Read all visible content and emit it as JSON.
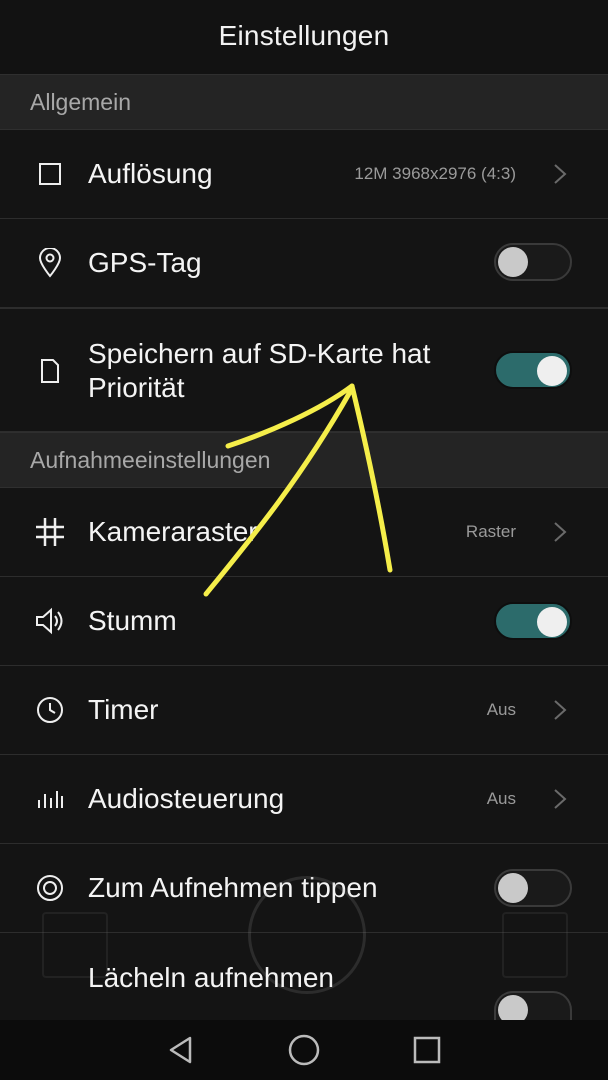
{
  "header": {
    "title": "Einstellungen"
  },
  "sections": {
    "general": "Allgemein",
    "recording": "Aufnahmeeinstellungen"
  },
  "rows": {
    "resolution": {
      "label": "Auflösung",
      "value": "12M 3968x2976 (4:3)"
    },
    "gps": {
      "label": "GPS-Tag",
      "toggle": "off"
    },
    "sd": {
      "label_line1": "Speichern auf SD-Karte hat",
      "label_line2": "Priorität",
      "toggle": "on"
    },
    "grid": {
      "label": "Kameraraster",
      "value": "Raster"
    },
    "mute": {
      "label": "Stumm",
      "toggle": "on"
    },
    "timer": {
      "label": "Timer",
      "value": "Aus"
    },
    "audio": {
      "label": "Audiosteuerung",
      "value": "Aus"
    },
    "tap": {
      "label": "Zum Aufnehmen tippen",
      "toggle": "off"
    },
    "smile": {
      "label": "Lächeln aufnehmen"
    }
  },
  "colors": {
    "toggle_on": "#2c6b6b",
    "annotation": "#f5ee4a"
  },
  "icons": [
    "flash-icon",
    "square-icon",
    "location-pin-icon",
    "file-icon",
    "grid-icon",
    "speaker-icon",
    "clock-icon",
    "equalizer-icon",
    "target-icon",
    "chevron-right-icon",
    "back-icon",
    "home-icon",
    "recents-icon"
  ]
}
